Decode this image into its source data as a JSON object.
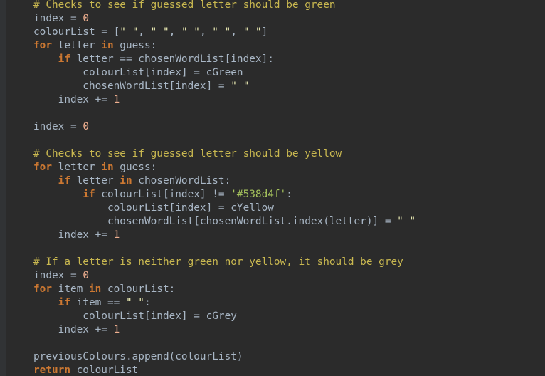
{
  "colors": {
    "background": "#2b2b2b",
    "gutter": "#313335",
    "plain": "#a9b7c6",
    "comment": "#c9b850",
    "keyword": "#cc7832",
    "number": "#f0b090",
    "string": "#e6e6b0",
    "string_hex": "#a5c25c"
  },
  "code_lines": [
    [
      {
        "t": "comment",
        "v": "# Checks to see if guessed letter should be green"
      }
    ],
    [
      {
        "t": "plain",
        "v": "index = "
      },
      {
        "t": "number",
        "v": "0"
      }
    ],
    [
      {
        "t": "plain",
        "v": "colourList = ["
      },
      {
        "t": "string",
        "v": "\" \""
      },
      {
        "t": "plain",
        "v": ", "
      },
      {
        "t": "string",
        "v": "\" \""
      },
      {
        "t": "plain",
        "v": ", "
      },
      {
        "t": "string",
        "v": "\" \""
      },
      {
        "t": "plain",
        "v": ", "
      },
      {
        "t": "string",
        "v": "\" \""
      },
      {
        "t": "plain",
        "v": ", "
      },
      {
        "t": "string",
        "v": "\" \""
      },
      {
        "t": "plain",
        "v": "]"
      }
    ],
    [
      {
        "t": "keyword",
        "v": "for"
      },
      {
        "t": "plain",
        "v": " letter "
      },
      {
        "t": "keyword",
        "v": "in"
      },
      {
        "t": "plain",
        "v": " guess:"
      }
    ],
    [
      {
        "t": "plain",
        "v": "    "
      },
      {
        "t": "keyword",
        "v": "if"
      },
      {
        "t": "plain",
        "v": " letter == chosenWordList[index]:"
      }
    ],
    [
      {
        "t": "plain",
        "v": "        colourList[index] = cGreen"
      }
    ],
    [
      {
        "t": "plain",
        "v": "        chosenWordList[index] = "
      },
      {
        "t": "string",
        "v": "\" \""
      }
    ],
    [
      {
        "t": "plain",
        "v": "    index += "
      },
      {
        "t": "number",
        "v": "1"
      }
    ],
    [],
    [
      {
        "t": "plain",
        "v": "index = "
      },
      {
        "t": "number",
        "v": "0"
      }
    ],
    [],
    [
      {
        "t": "comment",
        "v": "# Checks to see if guessed letter should be yellow"
      }
    ],
    [
      {
        "t": "keyword",
        "v": "for"
      },
      {
        "t": "plain",
        "v": " letter "
      },
      {
        "t": "keyword",
        "v": "in"
      },
      {
        "t": "plain",
        "v": " guess:"
      }
    ],
    [
      {
        "t": "plain",
        "v": "    "
      },
      {
        "t": "keyword",
        "v": "if"
      },
      {
        "t": "plain",
        "v": " letter "
      },
      {
        "t": "keyword",
        "v": "in"
      },
      {
        "t": "plain",
        "v": " chosenWordList:"
      }
    ],
    [
      {
        "t": "plain",
        "v": "        "
      },
      {
        "t": "keyword",
        "v": "if"
      },
      {
        "t": "plain",
        "v": " colourList[index] != "
      },
      {
        "t": "string-hex",
        "v": "'#538d4f'"
      },
      {
        "t": "plain",
        "v": ":"
      }
    ],
    [
      {
        "t": "plain",
        "v": "            colourList[index] = cYellow"
      }
    ],
    [
      {
        "t": "plain",
        "v": "            chosenWordList[chosenWordList.index(letter)] = "
      },
      {
        "t": "string",
        "v": "\" \""
      }
    ],
    [
      {
        "t": "plain",
        "v": "    index += "
      },
      {
        "t": "number",
        "v": "1"
      }
    ],
    [],
    [
      {
        "t": "comment",
        "v": "# If a letter is neither green nor yellow, it should be grey"
      }
    ],
    [
      {
        "t": "plain",
        "v": "index = "
      },
      {
        "t": "number",
        "v": "0"
      }
    ],
    [
      {
        "t": "keyword",
        "v": "for"
      },
      {
        "t": "plain",
        "v": " item "
      },
      {
        "t": "keyword",
        "v": "in"
      },
      {
        "t": "plain",
        "v": " colourList:"
      }
    ],
    [
      {
        "t": "plain",
        "v": "    "
      },
      {
        "t": "keyword",
        "v": "if"
      },
      {
        "t": "plain",
        "v": " item == "
      },
      {
        "t": "string",
        "v": "\" \""
      },
      {
        "t": "plain",
        "v": ":"
      }
    ],
    [
      {
        "t": "plain",
        "v": "        colourList[index] = cGrey"
      }
    ],
    [
      {
        "t": "plain",
        "v": "    index += "
      },
      {
        "t": "number",
        "v": "1"
      }
    ],
    [],
    [
      {
        "t": "plain",
        "v": "previousColours.append(colourList)"
      }
    ],
    [
      {
        "t": "keyword",
        "v": "return"
      },
      {
        "t": "plain",
        "v": " colourList"
      }
    ]
  ]
}
